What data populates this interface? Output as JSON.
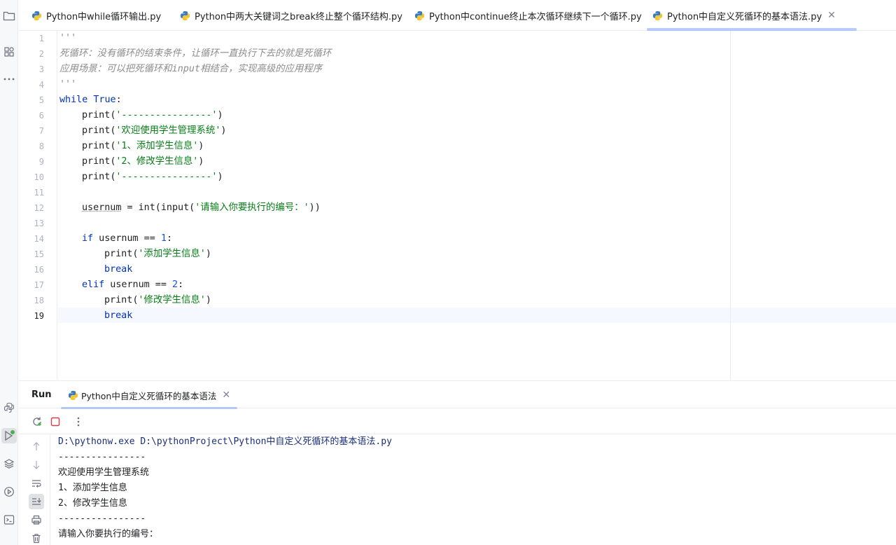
{
  "colors": {
    "accent": "#3574f0",
    "keyword": "#0033b3",
    "string": "#067d17",
    "number": "#1750eb",
    "comment": "#8c8c8c"
  },
  "tabs": [
    {
      "label": "Python中while循环输出.py"
    },
    {
      "label": "Python中两大关键词之break终止整个循环结构.py"
    },
    {
      "label": "Python中continue终止本次循环继续下一个循环.py"
    },
    {
      "label": "Python中自定义死循环的基本语法.py",
      "active": true
    }
  ],
  "editor": {
    "line_numbers": [
      "1",
      "2",
      "3",
      "4",
      "5",
      "6",
      "7",
      "8",
      "9",
      "10",
      "11",
      "12",
      "13",
      "14",
      "15",
      "16",
      "17",
      "18",
      "19"
    ],
    "code": {
      "l1": "'''",
      "l2": "死循环：没有循环的结束条件，让循环一直执行下去的就是死循环",
      "l3": "应用场景：可以把死循环和input相结合，实现高级的应用程序",
      "l4": "'''",
      "l5_kw": "while",
      "l5_true": "True",
      "l5_rest": ":",
      "fn_print": "print",
      "l6_str": "'----------------'",
      "l7_str": "'欢迎使用学生管理系统'",
      "l8_str": "'1、添加学生信息'",
      "l9_str": "'2、修改学生信息'",
      "l10_str": "'----------------'",
      "l12_var": "usernum",
      "l12_mid": " = int(input(",
      "l12_str": "'请输入你要执行的编号：'",
      "l12_end": "))",
      "kw_if": "if",
      "kw_elif": "elif",
      "kw_break": "break",
      "cond_var": " usernum == ",
      "num1": "1",
      "num2": "2",
      "colon": ":",
      "l15_str": "'添加学生信息'",
      "l18_str": "'修改学生信息'"
    }
  },
  "run": {
    "title": "Run",
    "tab_label": "Python中自定义死循环的基本语法",
    "output": [
      "D:\\pythonw.exe D:\\pythonProject\\Python中自定义死循环的基本语法.py",
      "----------------",
      "欢迎使用学生管理系统",
      "1、添加学生信息",
      "2、修改学生信息",
      "----------------",
      "请输入你要执行的编号："
    ]
  }
}
